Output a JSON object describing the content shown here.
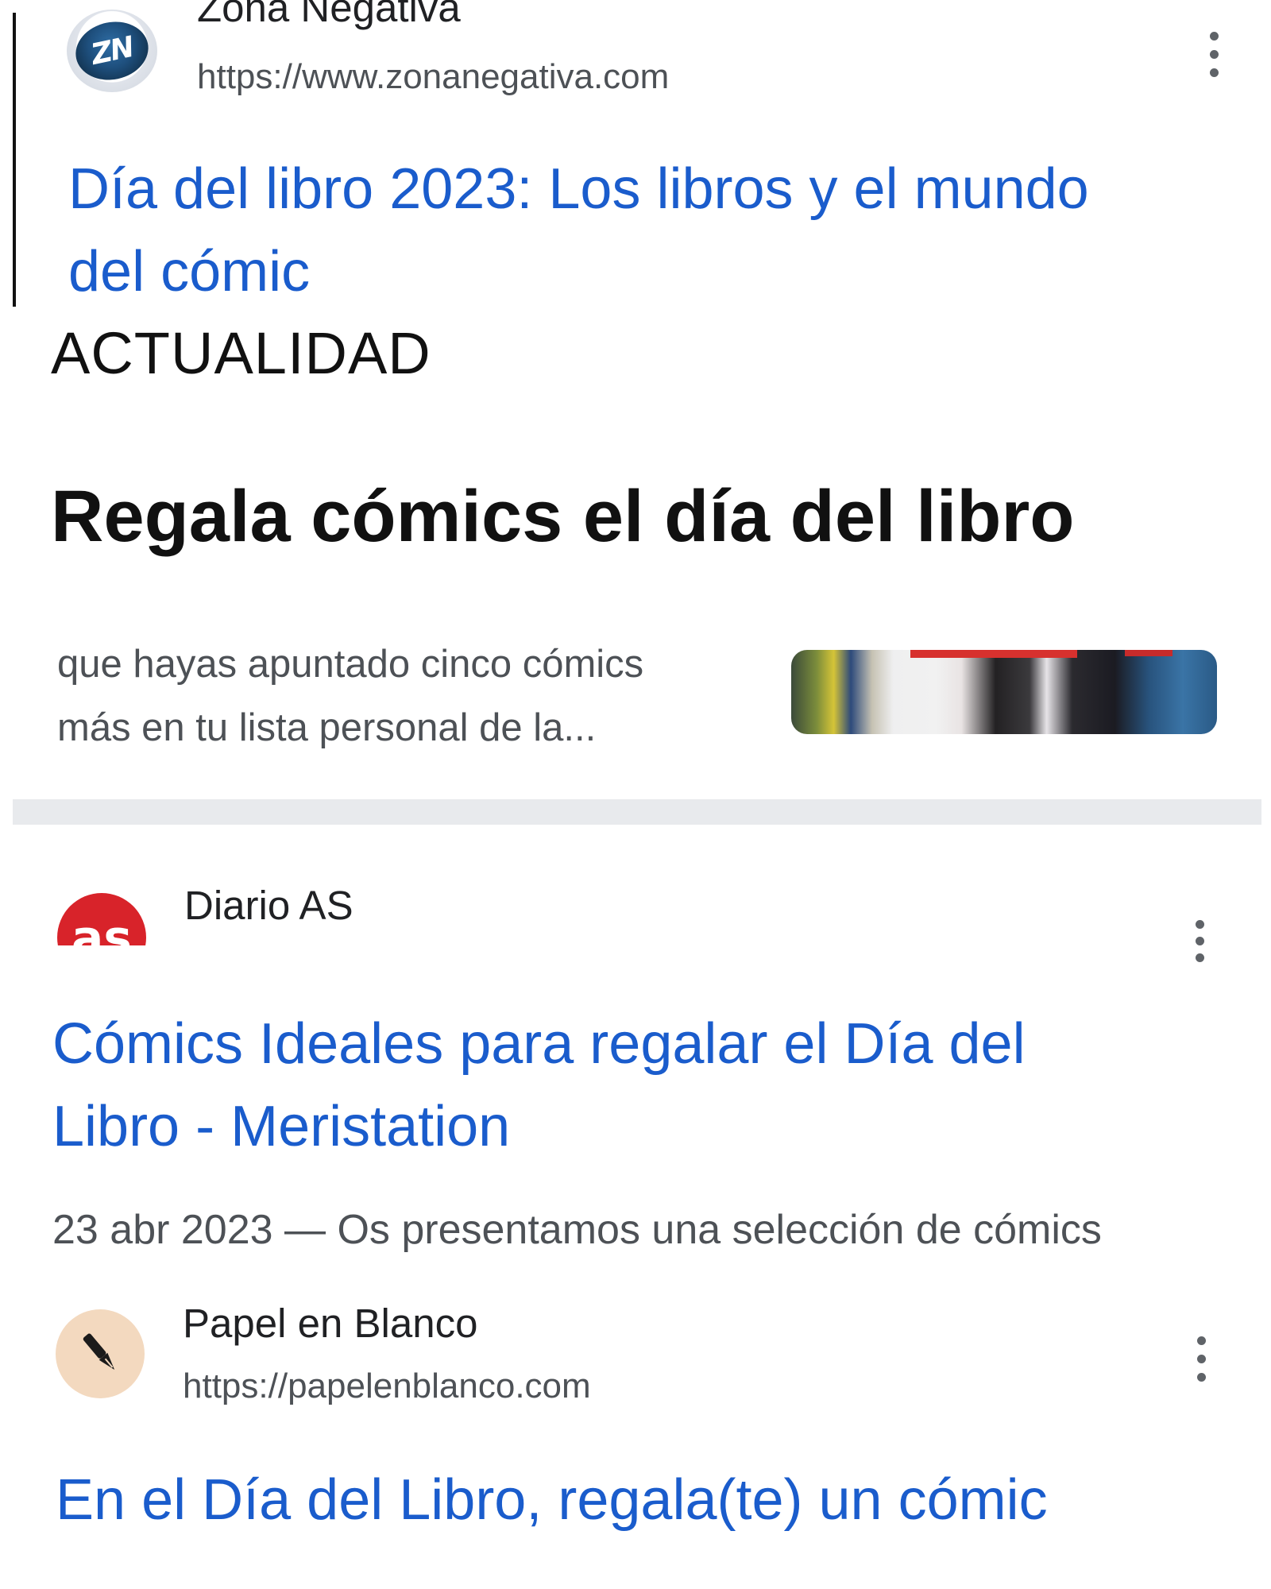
{
  "results": [
    {
      "site_name": "Zona Negativa",
      "url": "https://www.zonanegativa.com",
      "favicon": "zn-logo-icon",
      "title_line1": "Día del libro 2023: Los libros y el mundo",
      "title_line2": "del cómic",
      "section": "ACTUALIDAD",
      "headline": "Regala cómics el día del libro",
      "snippet_line1": "que hayas apuntado cinco cómics",
      "snippet_line2": "más en tu lista personal de la..."
    },
    {
      "site_name": "Diario AS",
      "favicon": "as-logo-icon",
      "favicon_text": "as",
      "title_line1": "Cómics Ideales para regalar el Día del",
      "title_line2": "Libro - Meristation",
      "snippet": "23 abr 2023 — Os presentamos una selección de cómics"
    },
    {
      "site_name": "Papel en Blanco",
      "url": "https://papelenblanco.com",
      "favicon": "fountain-pen-icon",
      "title": "En el Día del Libro, regala(te) un cómic"
    }
  ],
  "colors": {
    "link": "#1a5ccc",
    "url": "#4d5156",
    "divider": "#e8eaed",
    "as_red": "#d8232a",
    "pen_bg": "#f3d9bf"
  }
}
